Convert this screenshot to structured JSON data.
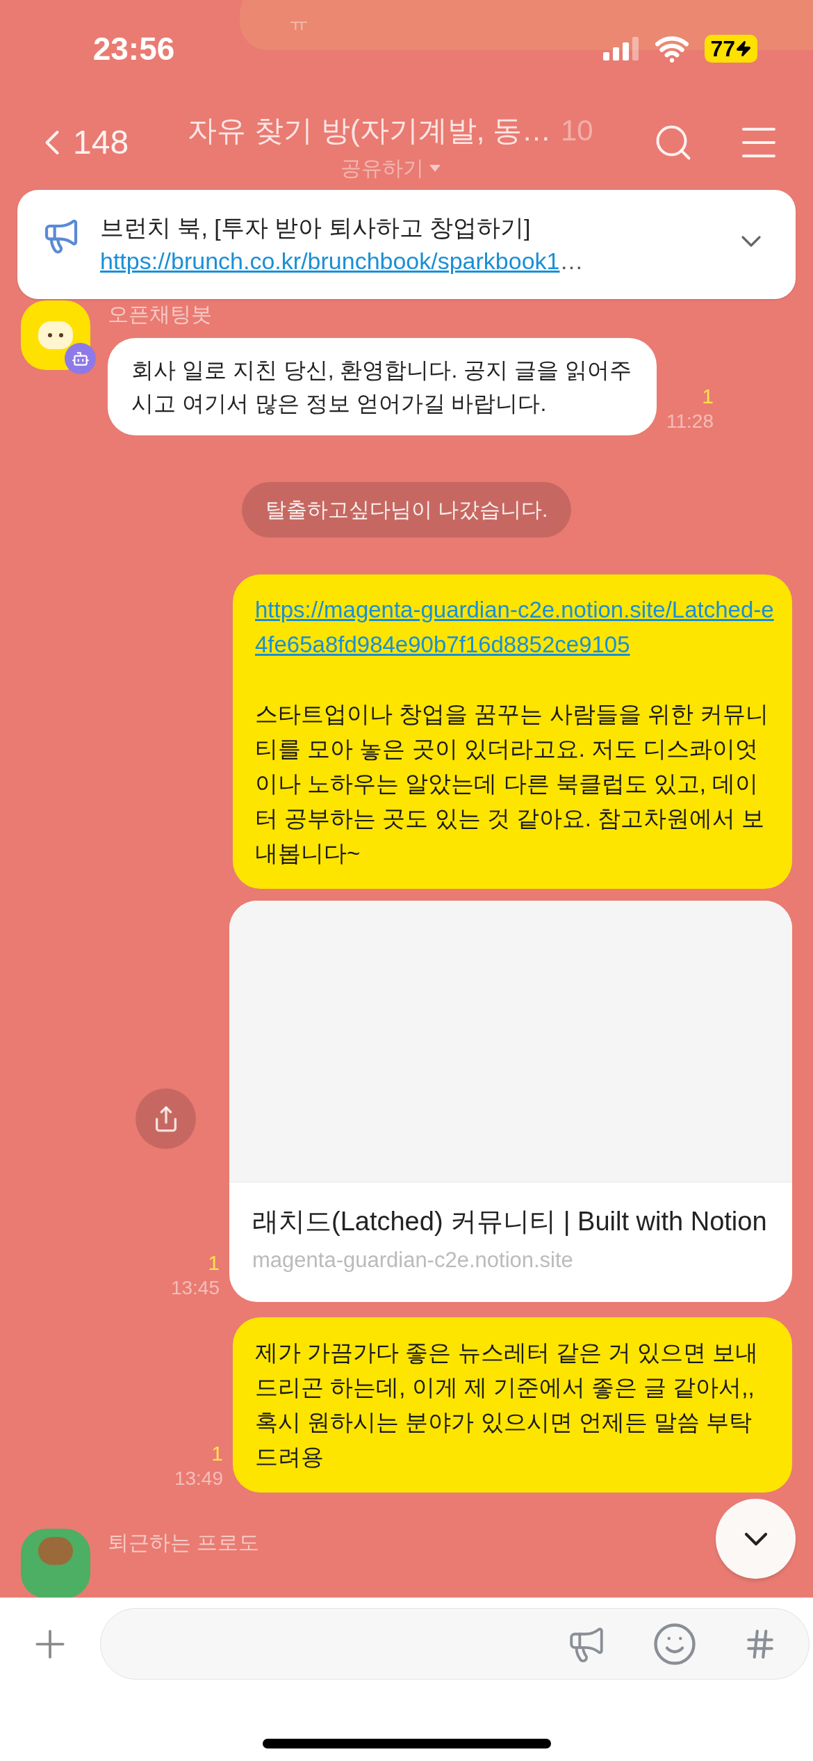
{
  "status_bar": {
    "time": "23:56",
    "battery": "77"
  },
  "ghost_bubble": {
    "text": "ㅠ"
  },
  "header": {
    "back_count": "148",
    "title": "자유 찾기 방(자기계발, 동…",
    "member_count": "10",
    "share_label": "공유하기"
  },
  "notice": {
    "title": "브런치 북, [투자 받아 퇴사하고 창업하기]",
    "link": "https://brunch.co.kr/brunchbook/sparkbook1",
    "link_cut": "…"
  },
  "messages": [
    {
      "kind": "incoming",
      "sender": "오픈채팅봇",
      "text": "회사 일로 지친 당신, 환영합니다. 공지 글을 읽어주시고 여기서 많은 정보 얻어가길 바랍니다.",
      "unread": "1",
      "time": "11:28"
    },
    {
      "kind": "system",
      "text": "탈출하고싶다님이 나갔습니다."
    },
    {
      "kind": "mine",
      "link": "https://magenta-guardian-c2e.notion.site/Latched-e4fe65a8fd984e90b7f16d8852ce9105",
      "text": "스타트업이나 창업을 꿈꾸는 사람들을 위한 커뮤니티를 모아 놓은 곳이 있더라고요. 저도 디스콰이엇이나 노하우는 알았는데 다른 북클럽도 있고, 데이터 공부하는 곳도 있는 것 같아요. 참고차원에서 보내봅니다~"
    },
    {
      "kind": "link_card",
      "title": "래치드(Latched) 커뮤니티 | Built with Notion",
      "domain": "magenta-guardian-c2e.notion.site",
      "unread": "1",
      "time": "13:45"
    },
    {
      "kind": "mine",
      "text": "제가 가끔가다 좋은 뉴스레터 같은 거 있으면 보내드리곤 하는데, 이게 제 기준에서 좋은 글 같아서,, 혹시 원하시는 분야가 있으시면 언제든 말씀 부탁 드려용",
      "unread": "1",
      "time": "13:49"
    },
    {
      "kind": "incoming_cut",
      "sender": "퇴근하는 프로도"
    }
  ]
}
